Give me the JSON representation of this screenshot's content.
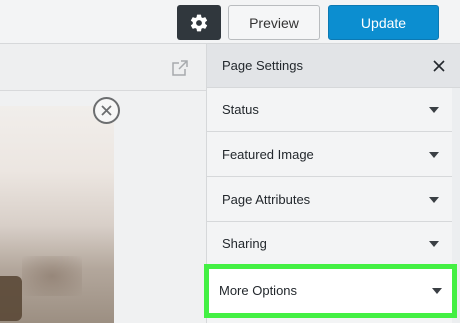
{
  "toolbar": {
    "settings_icon": "gear-icon",
    "preview_label": "Preview",
    "update_label": "Update",
    "colors": {
      "settings_bg": "#30373d",
      "update_bg": "#0c8ed0"
    }
  },
  "editor": {
    "open_external_icon": "external-link-icon",
    "remove_image_icon": "remove-circle-icon"
  },
  "sidebar": {
    "header": {
      "title": "Page Settings",
      "close_icon": "close-icon"
    },
    "panels": [
      {
        "label": "Status",
        "icon": "chevron-down-icon"
      },
      {
        "label": "Featured Image",
        "icon": "chevron-down-icon"
      },
      {
        "label": "Page Attributes",
        "icon": "chevron-down-icon"
      },
      {
        "label": "Sharing",
        "icon": "chevron-down-icon"
      },
      {
        "label": "More Options",
        "icon": "chevron-down-icon",
        "highlighted": true
      }
    ],
    "highlight_color": "#43f043"
  }
}
